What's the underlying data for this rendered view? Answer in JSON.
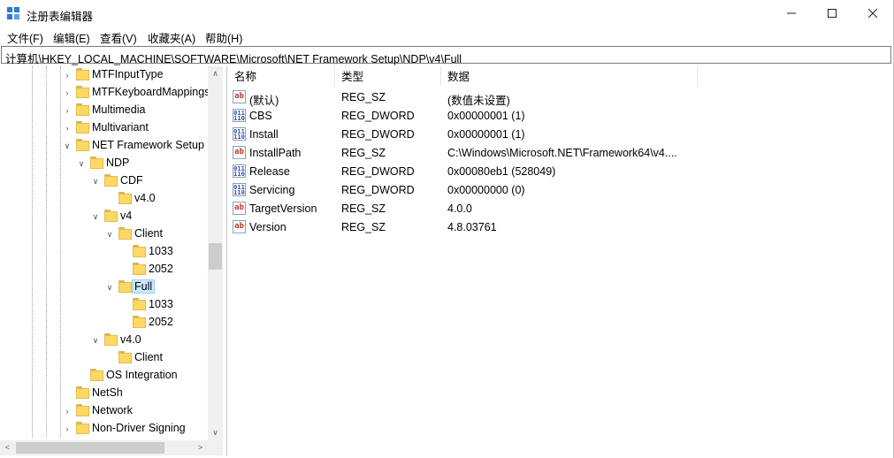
{
  "window": {
    "title": "注册表编辑器"
  },
  "menu": [
    "文件(F)",
    "编辑(E)",
    "查看(V)",
    "收藏夹(A)",
    "帮助(H)"
  ],
  "address": "计算机\\HKEY_LOCAL_MACHINE\\SOFTWARE\\Microsoft\\NET Framework Setup\\NDP\\v4\\Full",
  "tree": [
    {
      "label": "MTFInputType",
      "level": 0,
      "expander": "right"
    },
    {
      "label": "MTFKeyboardMappings",
      "level": 0,
      "expander": "right"
    },
    {
      "label": "Multimedia",
      "level": 0,
      "expander": "right"
    },
    {
      "label": "Multivariant",
      "level": 0,
      "expander": "right"
    },
    {
      "label": "NET Framework Setup",
      "level": 0,
      "expander": "down"
    },
    {
      "label": "NDP",
      "level": 1,
      "expander": "down"
    },
    {
      "label": "CDF",
      "level": 2,
      "expander": "down"
    },
    {
      "label": "v4.0",
      "level": 3,
      "expander": "none"
    },
    {
      "label": "v4",
      "level": 2,
      "expander": "down"
    },
    {
      "label": "Client",
      "level": 3,
      "expander": "down"
    },
    {
      "label": "1033",
      "level": 4,
      "expander": "none"
    },
    {
      "label": "2052",
      "level": 4,
      "expander": "none"
    },
    {
      "label": "Full",
      "level": 3,
      "expander": "down",
      "selected": true
    },
    {
      "label": "1033",
      "level": 4,
      "expander": "none"
    },
    {
      "label": "2052",
      "level": 4,
      "expander": "none"
    },
    {
      "label": "v4.0",
      "level": 2,
      "expander": "down"
    },
    {
      "label": "Client",
      "level": 3,
      "expander": "none"
    },
    {
      "label": "OS Integration",
      "level": 1,
      "expander": "none"
    },
    {
      "label": "NetSh",
      "level": 0,
      "expander": "none"
    },
    {
      "label": "Network",
      "level": 0,
      "expander": "right"
    },
    {
      "label": "Non-Driver Signing",
      "level": 0,
      "expander": "right"
    }
  ],
  "columns": {
    "name": "名称",
    "type": "类型",
    "data": "数据"
  },
  "values": [
    {
      "name": "(默认)",
      "type": "REG_SZ",
      "data": "(数值未设置)",
      "icon": "sz"
    },
    {
      "name": "CBS",
      "type": "REG_DWORD",
      "data": "0x00000001 (1)",
      "icon": "dword"
    },
    {
      "name": "Install",
      "type": "REG_DWORD",
      "data": "0x00000001 (1)",
      "icon": "dword"
    },
    {
      "name": "InstallPath",
      "type": "REG_SZ",
      "data": "C:\\Windows\\Microsoft.NET\\Framework64\\v4....",
      "icon": "sz"
    },
    {
      "name": "Release",
      "type": "REG_DWORD",
      "data": "0x00080eb1 (528049)",
      "icon": "dword"
    },
    {
      "name": "Servicing",
      "type": "REG_DWORD",
      "data": "0x00000000 (0)",
      "icon": "dword"
    },
    {
      "name": "TargetVersion",
      "type": "REG_SZ",
      "data": "4.0.0",
      "icon": "sz"
    },
    {
      "name": "Version",
      "type": "REG_SZ",
      "data": "4.8.03761",
      "icon": "sz"
    }
  ]
}
